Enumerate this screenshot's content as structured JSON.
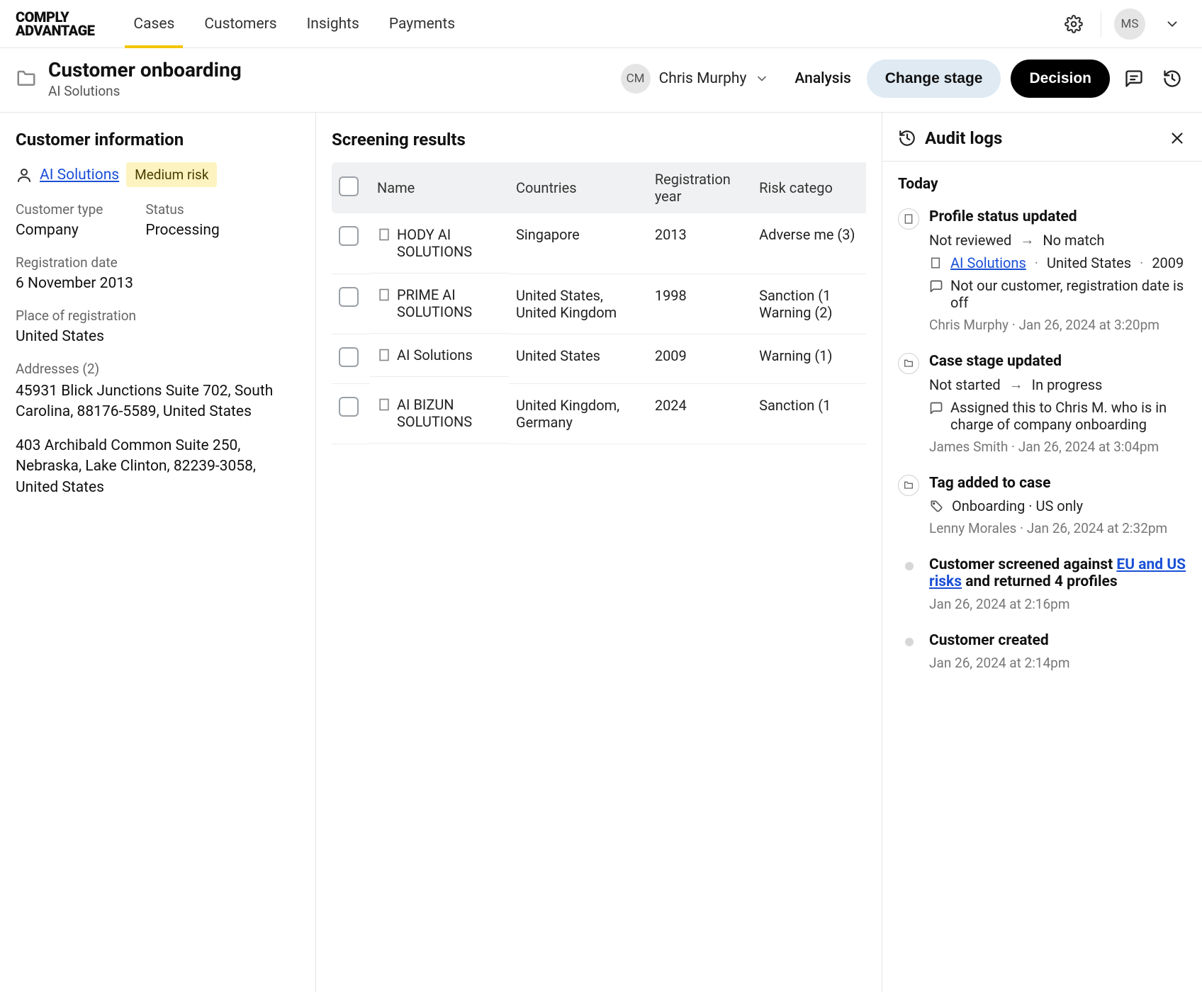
{
  "brand": {
    "line1": "COMPLY",
    "line2": "ADVANTAGE"
  },
  "nav": {
    "tabs": [
      {
        "label": "Cases",
        "active": true
      },
      {
        "label": "Customers",
        "active": false
      },
      {
        "label": "Insights",
        "active": false
      },
      {
        "label": "Payments",
        "active": false
      }
    ],
    "user_initials": "MS"
  },
  "case": {
    "title": "Customer onboarding",
    "subtitle": "AI Solutions",
    "assignee_initials": "CM",
    "assignee_name": "Chris Murphy",
    "analysis_label": "Analysis",
    "change_stage_label": "Change stage",
    "decision_label": "Decision"
  },
  "customer_info": {
    "section_title": "Customer information",
    "name": "AI Solutions",
    "risk_level": "Medium risk",
    "fields": {
      "customer_type_label": "Customer type",
      "customer_type_value": "Company",
      "status_label": "Status",
      "status_value": "Processing",
      "registration_date_label": "Registration date",
      "registration_date_value": "6 November 2013",
      "place_of_registration_label": "Place of registration",
      "place_of_registration_value": "United States",
      "addresses_label": "Addresses (2)"
    },
    "addresses": [
      "45931 Blick Junctions Suite 702, South Carolina, 88176-5589, United States",
      "403 Archibald Common Suite 250, Nebraska, Lake Clinton, 82239-3058, United States"
    ]
  },
  "screening": {
    "section_title": "Screening results",
    "columns": [
      "Name",
      "Countries",
      "Registration year",
      "Risk catego"
    ],
    "rows": [
      {
        "name": "HODY AI SOLUTIONS",
        "countries": "Singapore",
        "year": "2013",
        "risk": "Adverse me (3)"
      },
      {
        "name": "PRIME AI SOLUTIONS",
        "countries": "United States, United Kingdom",
        "year": "1998",
        "risk": "Sanction (1 Warning (2)"
      },
      {
        "name": "AI Solutions",
        "countries": "United States",
        "year": "2009",
        "risk": "Warning (1)"
      },
      {
        "name": "AI BIZUN SOLUTIONS",
        "countries": "United Kingdom, Germany",
        "year": "2024",
        "risk": "Sanction (1"
      }
    ]
  },
  "audit": {
    "section_title": "Audit logs",
    "day_label": "Today",
    "items": [
      {
        "icon": "building",
        "title": "Profile status updated",
        "from": "Not reviewed",
        "to": "No match",
        "entity_name": "AI Solutions",
        "entity_country": "United States",
        "entity_year": "2009",
        "note": "Not our customer, registration date is off",
        "actor": "Chris Murphy",
        "timestamp": "Jan 26, 2024 at 3:20pm"
      },
      {
        "icon": "folder",
        "title": "Case stage updated",
        "from": "Not started",
        "to": "In progress",
        "note": "Assigned this to Chris M. who is in charge of company onboarding",
        "actor": "James Smith",
        "timestamp": "Jan 26, 2024 at 3:04pm"
      },
      {
        "icon": "folder",
        "title": "Tag added to case",
        "tags_text": "Onboarding · US only",
        "actor": "Lenny Morales",
        "timestamp": "Jan 26, 2024 at 2:32pm"
      },
      {
        "icon": "dot",
        "title_pre": "Customer screened against ",
        "title_link": "EU and US risks",
        "title_post": " and returned 4 profiles",
        "timestamp": "Jan 26, 2024 at 2:16pm"
      },
      {
        "icon": "dot",
        "title": "Customer created",
        "timestamp": "Jan 26, 2024 at 2:14pm"
      }
    ]
  }
}
